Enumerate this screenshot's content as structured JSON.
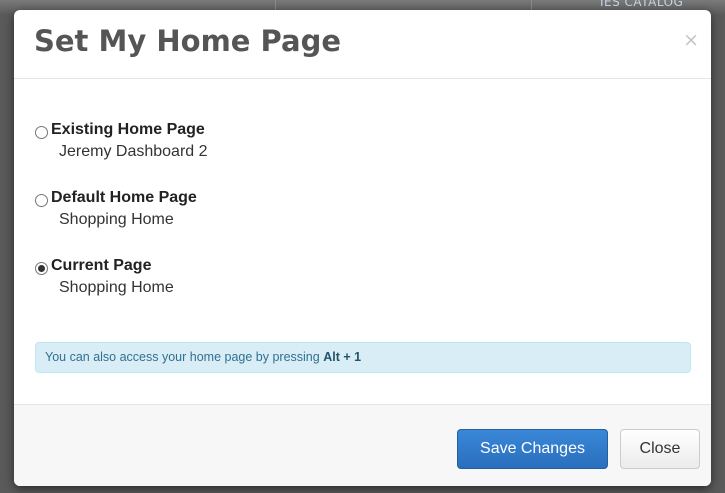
{
  "background": {
    "partial_text": "IES CATALOG"
  },
  "dialog": {
    "title": "Set My Home Page",
    "close_glyph": "×",
    "options": [
      {
        "title": "Existing Home Page",
        "subtitle": "Jeremy Dashboard 2",
        "checked": false
      },
      {
        "title": "Default Home Page",
        "subtitle": "Shopping Home",
        "checked": false
      },
      {
        "title": "Current Page",
        "subtitle": "Shopping Home",
        "checked": true
      }
    ],
    "info": {
      "text": "You can also access your home page by pressing ",
      "shortcut": "Alt + 1"
    },
    "buttons": {
      "save": "Save Changes",
      "close": "Close"
    }
  },
  "colors": {
    "primary": "#2f7bcf",
    "info_bg": "#d9edf7",
    "info_text": "#31708f",
    "title_text": "#555555"
  }
}
